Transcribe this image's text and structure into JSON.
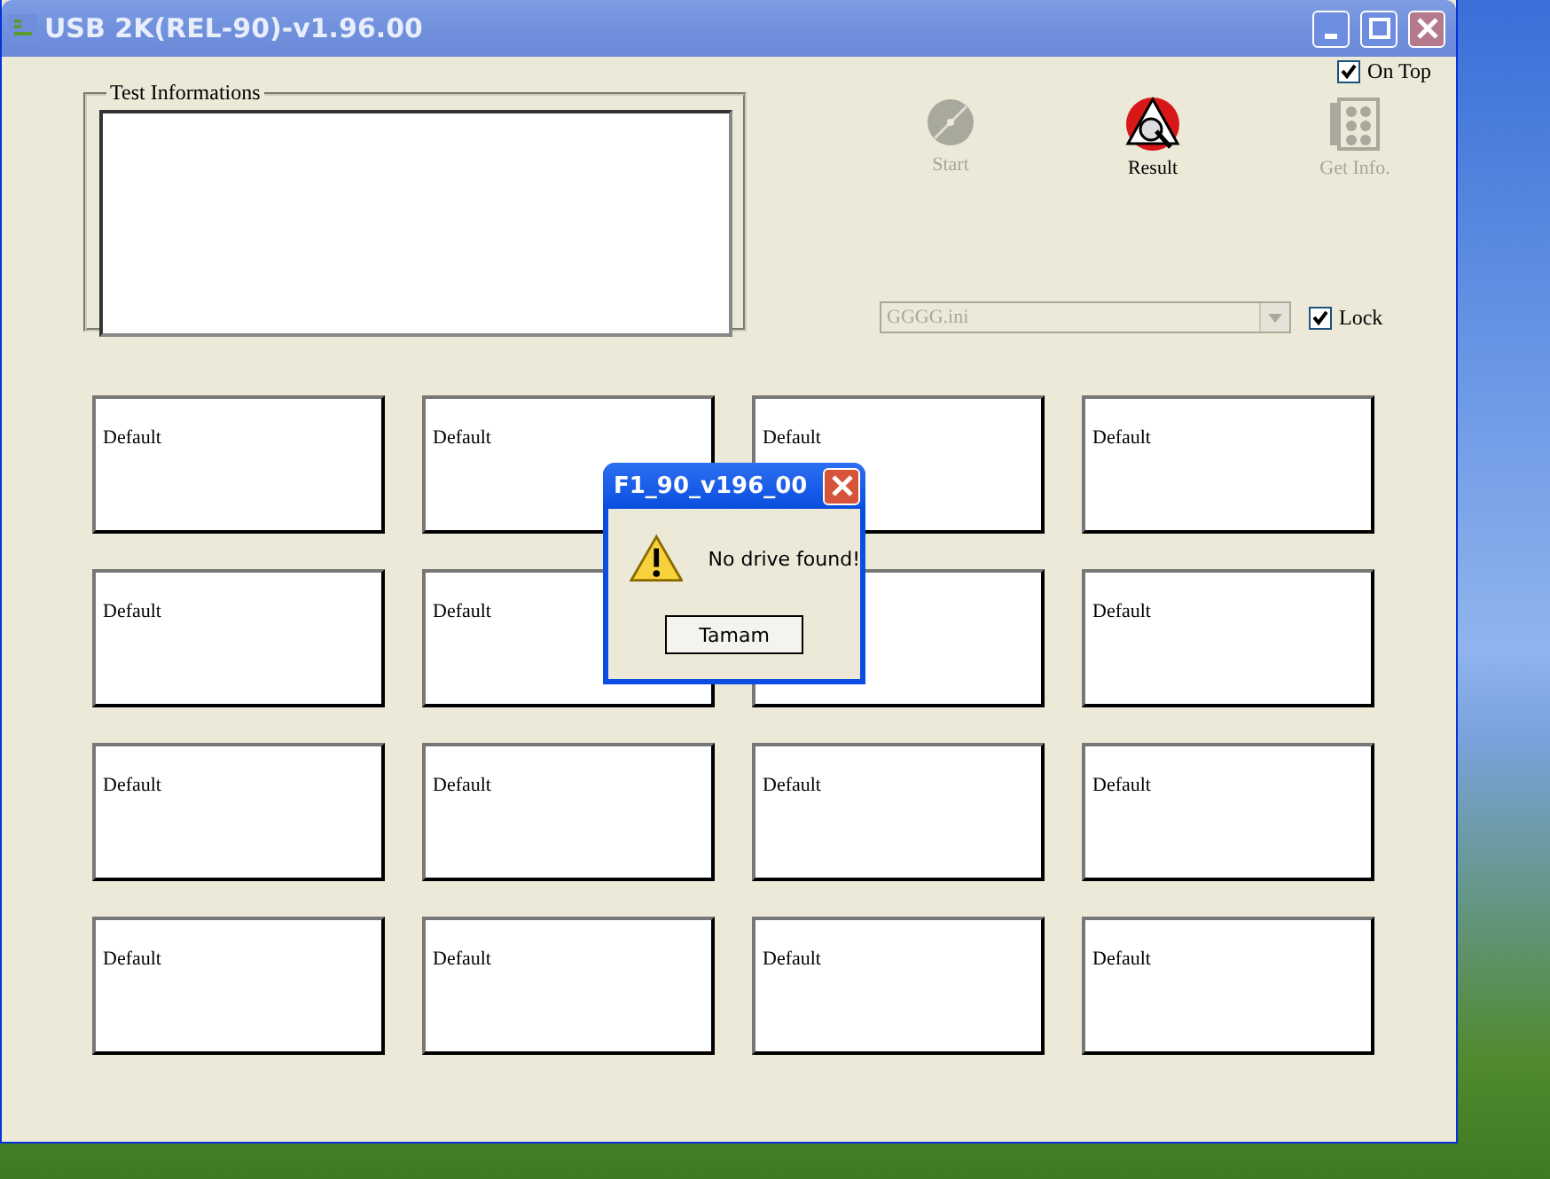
{
  "window": {
    "title": "USB 2K(REL-90)-v1.96.00"
  },
  "on_top": {
    "label": "On Top",
    "checked": true
  },
  "test_info": {
    "legend": "Test Informations"
  },
  "toolbar": [
    {
      "kind": "start",
      "label": "Start",
      "disabled": true
    },
    {
      "kind": "result",
      "label": "Result",
      "disabled": false
    },
    {
      "kind": "info",
      "label": "Get Info.",
      "disabled": true
    }
  ],
  "config_select": {
    "value": "GGGG.ini",
    "disabled": true
  },
  "lock": {
    "label": "Lock",
    "checked": true
  },
  "slots": [
    {
      "kind": "labeled",
      "label": "Default"
    },
    {
      "kind": "labeled",
      "label": "Default"
    },
    {
      "kind": "labeled",
      "label": "Default"
    },
    {
      "kind": "labeled",
      "label": "Default"
    },
    {
      "kind": "labeled",
      "label": "Default"
    },
    {
      "kind": "labeled",
      "label": "Default"
    },
    {
      "kind": "covered"
    },
    {
      "kind": "labeled",
      "label": "Default"
    },
    {
      "kind": "labeled",
      "label": "Default"
    },
    {
      "kind": "labeled",
      "label": "Default"
    },
    {
      "kind": "labeled",
      "label": "Default"
    },
    {
      "kind": "labeled",
      "label": "Default"
    },
    {
      "kind": "labeled",
      "label": "Default"
    },
    {
      "kind": "labeled",
      "label": "Default"
    },
    {
      "kind": "labeled",
      "label": "Default"
    },
    {
      "kind": "labeled",
      "label": "Default"
    }
  ],
  "dialog": {
    "title": "F1_90_v196_00",
    "message": "No drive found!",
    "button": "Tamam"
  }
}
